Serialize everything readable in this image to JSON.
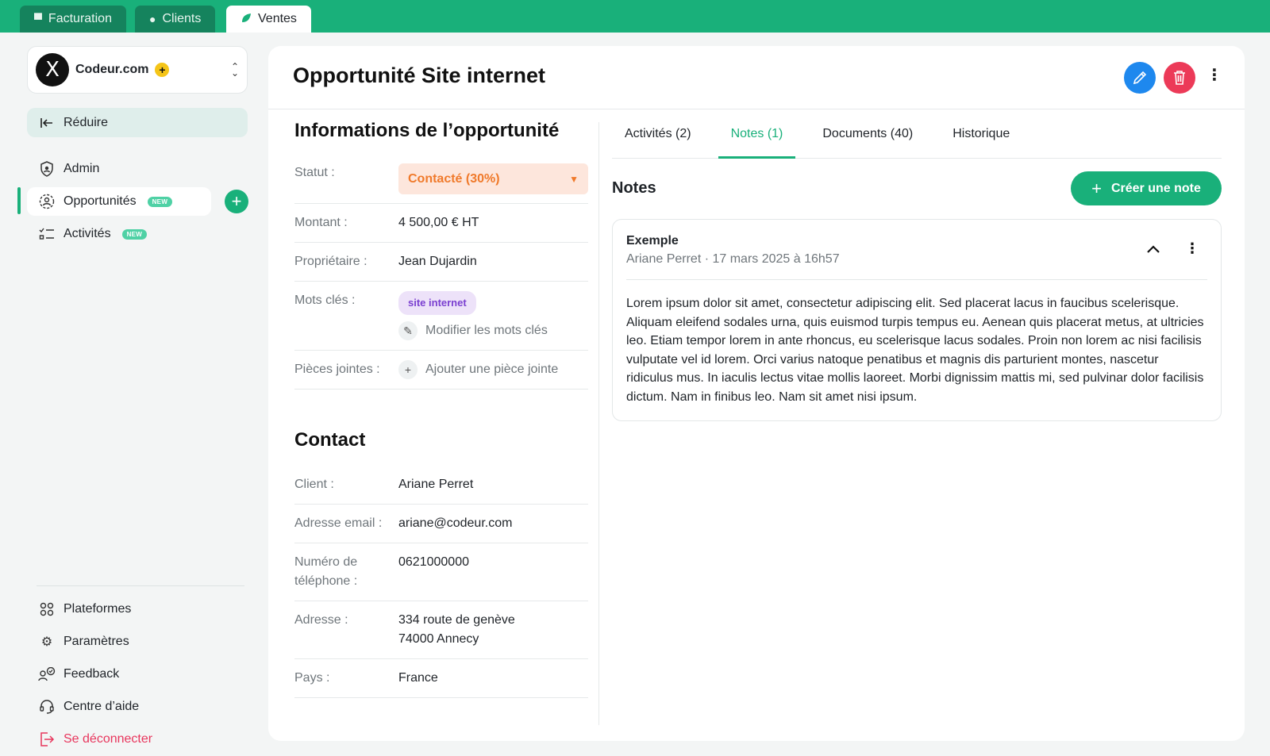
{
  "top_tabs": [
    {
      "label": "Facturation",
      "icon": "invoice-icon"
    },
    {
      "label": "Clients",
      "icon": "clients-icon"
    },
    {
      "label": "Ventes",
      "icon": "leaf-icon"
    }
  ],
  "sidebar": {
    "org_name": "Codeur.com",
    "org_logo": "X",
    "collapse_label": "Réduire",
    "items": [
      {
        "label": "Admin",
        "icon": "shield-icon"
      },
      {
        "label": "Opportunités",
        "badge": "NEW",
        "icon": "user-circle-icon"
      },
      {
        "label": "Activités",
        "badge": "NEW",
        "icon": "checklist-icon"
      }
    ],
    "bottom_items": [
      {
        "label": "Plateformes",
        "icon": "grid-icon"
      },
      {
        "label": "Paramètres",
        "icon": "gear-icon"
      },
      {
        "label": "Feedback",
        "icon": "feedback-icon"
      },
      {
        "label": "Centre d’aide",
        "icon": "headset-icon"
      },
      {
        "label": "Se déconnecter",
        "icon": "logout-icon"
      }
    ]
  },
  "page": {
    "title": "Opportunité Site internet"
  },
  "opportunity": {
    "section_title": "Informations de l’opportunité",
    "status_label": "Statut :",
    "status_value": "Contacté (30%)",
    "amount_label": "Montant :",
    "amount_value": "4 500,00 € HT",
    "owner_label": "Propriétaire :",
    "owner_value": "Jean Dujardin",
    "keywords_label": "Mots clés :",
    "keyword_tag": "site internet",
    "edit_keywords": "Modifier les mots clés",
    "attachments_label": "Pièces jointes :",
    "add_attachment": "Ajouter une pièce jointe"
  },
  "contact": {
    "section_title": "Contact",
    "client_label": "Client :",
    "client_value": "Ariane Perret",
    "email_label": "Adresse email :",
    "email_value": "ariane@codeur.com",
    "phone_label": "Numéro de téléphone :",
    "phone_value": "0621000000",
    "address_label": "Adresse :",
    "address_line1": "334 route de genève",
    "address_line2": "74000 Annecy",
    "country_label": "Pays :",
    "country_value": "France"
  },
  "right_tabs": [
    {
      "label": "Activités (2)",
      "active": false
    },
    {
      "label": "Notes (1)",
      "active": true
    },
    {
      "label": "Documents (40)",
      "active": false
    },
    {
      "label": "Historique",
      "active": false
    }
  ],
  "notes": {
    "title": "Notes",
    "create_label": "Créer une note",
    "items": [
      {
        "title": "Exemple",
        "meta": "Ariane Perret · 17 mars 2025 à 16h57",
        "body": "Lorem ipsum dolor sit amet, consectetur adipiscing elit. Sed placerat lacus in faucibus scelerisque. Aliquam eleifend sodales urna, quis euismod turpis tempus eu. Aenean quis placerat metus, at ultricies leo. Etiam tempor lorem in ante rhoncus, eu scelerisque lacus sodales. Proin non lorem ac nisi facilisis vulputate vel id lorem. Orci varius natoque penatibus et magnis dis parturient montes, nascetur ridiculus mus. In iaculis lectus vitae mollis laoreet. Morbi dignissim mattis mi, sed pulvinar dolor facilisis dictum. Nam in finibus leo. Nam sit amet nisi ipsum."
      }
    ]
  },
  "colors": {
    "brand_green": "#19b07a",
    "edit_blue": "#1e88ee",
    "delete_red": "#ec3a58",
    "status_orange": "#f07a2b",
    "tag_purple": "#7a3fd0"
  }
}
